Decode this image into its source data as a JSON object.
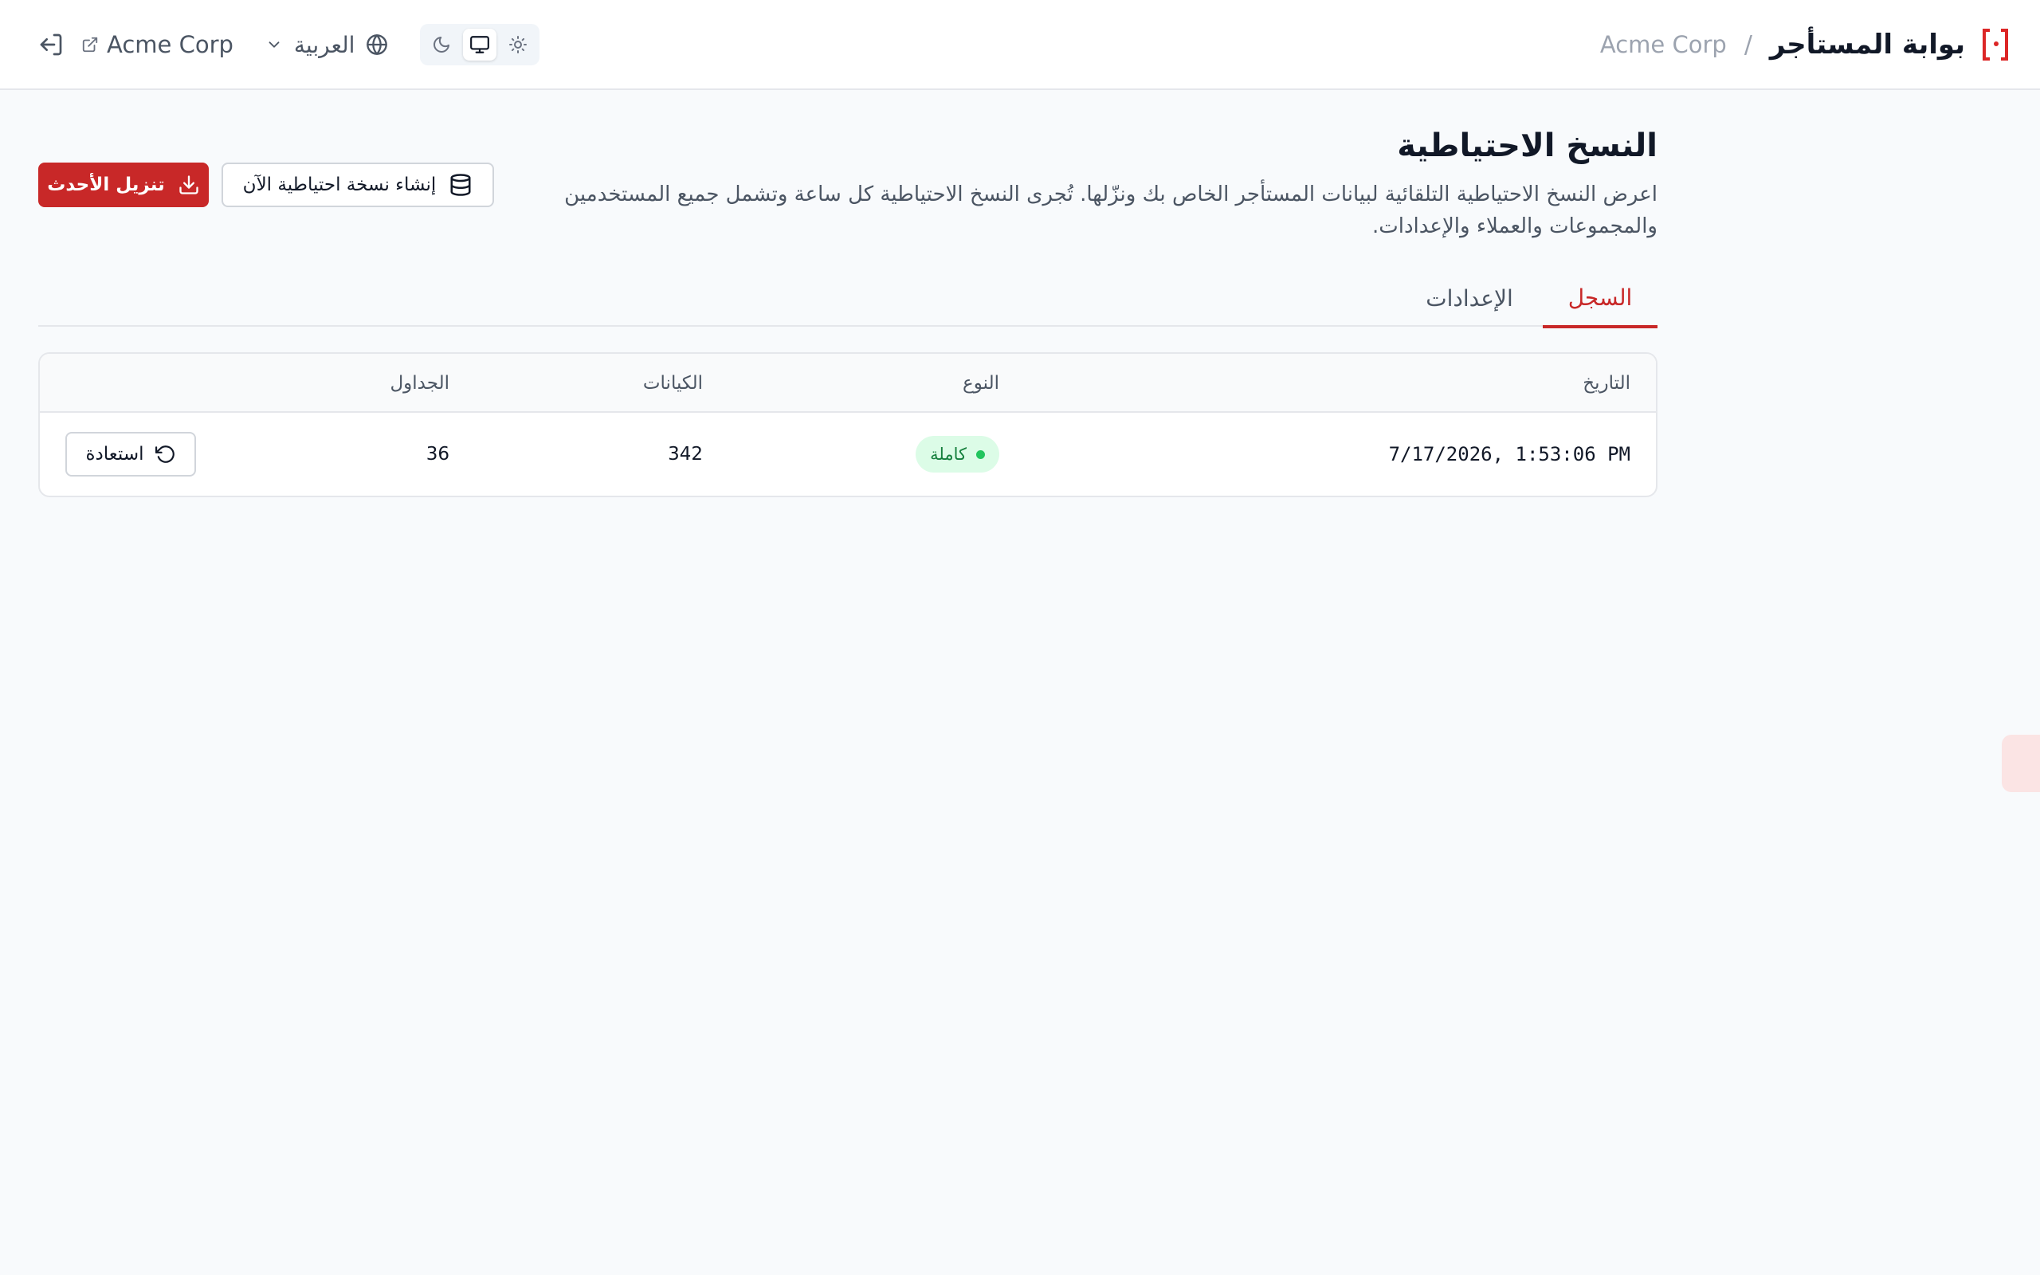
{
  "header": {
    "app_title": "بوابة المستأجر",
    "separator": "/",
    "tenant": "Acme Corp",
    "tenant_link": "Acme Corp",
    "language": "العربية",
    "theme_options": [
      "light",
      "system",
      "dark"
    ],
    "theme_selected": "system"
  },
  "page": {
    "title": "النسخ الاحتياطية",
    "description": "اعرض النسخ الاحتياطية التلقائية لبيانات المستأجر الخاص بك ونزّلها. تُجرى النسخ الاحتياطية كل ساعة وتشمل جميع المستخدمين والمجموعات والعملاء والإعدادات.",
    "primary_action": "تنزيل الأحدث",
    "secondary_action": "إنشاء نسخة احتياطية الآن"
  },
  "tabs": [
    {
      "label": "السجل",
      "active": true
    },
    {
      "label": "الإعدادات",
      "active": false
    }
  ],
  "table": {
    "columns": [
      "التاريخ",
      "النوع",
      "الكيانات",
      "الجداول"
    ],
    "rows": [
      {
        "date": "7/17/2026, 1:53:06 PM",
        "type": "كاملة",
        "entities": "342",
        "tables": "36",
        "action": "استعادة"
      }
    ]
  },
  "colors": {
    "accent": "#c82828",
    "success_bg": "#dcfce7",
    "success_text": "#15803d"
  }
}
